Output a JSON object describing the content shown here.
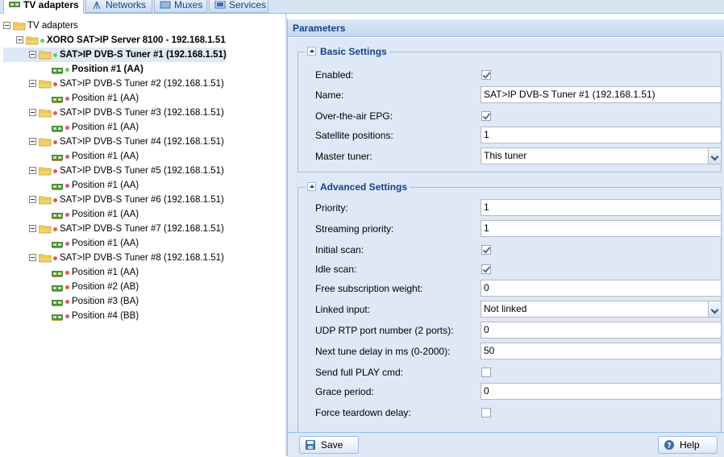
{
  "tabs": [
    {
      "label": "TV adapters",
      "icon": "tv-adapter-icon",
      "active": true
    },
    {
      "label": "Networks",
      "icon": "antenna-icon",
      "active": false
    },
    {
      "label": "Muxes",
      "icon": "mux-icon",
      "active": false
    },
    {
      "label": "Services",
      "icon": "services-icon",
      "active": false
    }
  ],
  "tree": {
    "root": "TV adapters",
    "server": "XORO SAT>IP Server 8100 - 192.168.1.51",
    "tuners": [
      {
        "label": "SAT>IP DVB-S Tuner #1 (192.168.1.51)",
        "status": "green",
        "positions": [
          "Position #1 (AA)"
        ]
      },
      {
        "label": "SAT>IP DVB-S Tuner #2 (192.168.1.51)",
        "status": "red",
        "positions": [
          "Position #1 (AA)"
        ]
      },
      {
        "label": "SAT>IP DVB-S Tuner #3 (192.168.1.51)",
        "status": "red",
        "positions": [
          "Position #1 (AA)"
        ]
      },
      {
        "label": "SAT>IP DVB-S Tuner #4 (192.168.1.51)",
        "status": "red",
        "positions": [
          "Position #1 (AA)"
        ]
      },
      {
        "label": "SAT>IP DVB-S Tuner #5 (192.168.1.51)",
        "status": "red",
        "positions": [
          "Position #1 (AA)"
        ]
      },
      {
        "label": "SAT>IP DVB-S Tuner #6 (192.168.1.51)",
        "status": "red",
        "positions": [
          "Position #1 (AA)"
        ]
      },
      {
        "label": "SAT>IP DVB-S Tuner #7 (192.168.1.51)",
        "status": "red",
        "positions": [
          "Position #1 (AA)"
        ]
      },
      {
        "label": "SAT>IP DVB-S Tuner #8 (192.168.1.51)",
        "status": "red",
        "positions": [
          "Position #1 (AA)",
          "Position #2 (AB)",
          "Position #3 (BA)",
          "Position #4 (BB)"
        ]
      }
    ]
  },
  "panel": {
    "title": "Parameters",
    "basic": {
      "legend": "Basic Settings",
      "enabled_label": "Enabled:",
      "enabled": true,
      "name_label": "Name:",
      "name_value": "SAT>IP DVB-S Tuner #1 (192.168.1.51)",
      "epg_label": "Over-the-air EPG:",
      "epg": true,
      "satpos_label": "Satellite positions:",
      "satpos_value": "1",
      "master_label": "Master tuner:",
      "master_value": "This tuner"
    },
    "advanced": {
      "legend": "Advanced Settings",
      "priority_label": "Priority:",
      "priority_value": "1",
      "stream_label": "Streaming priority:",
      "stream_value": "1",
      "initscan_label": "Initial scan:",
      "initscan": true,
      "idlescan_label": "Idle scan:",
      "idlescan": true,
      "freesub_label": "Free subscription weight:",
      "freesub_value": "0",
      "linked_label": "Linked input:",
      "linked_value": "Not linked",
      "udp_label": "UDP RTP port number (2 ports):",
      "udp_value": "0",
      "nexttune_label": "Next tune delay in ms (0-2000):",
      "nexttune_value": "50",
      "fullplay_label": "Send full PLAY cmd:",
      "fullplay": false,
      "grace_label": "Grace period:",
      "grace_value": "0",
      "teardown_label": "Force teardown delay:",
      "teardown": false
    },
    "save_label": "Save",
    "help_label": "Help"
  },
  "colors": {
    "selected_row": "#dfe8f6",
    "status_green": "#5fcf5f",
    "status_red": "#e25a5a",
    "header_text": "#15428b"
  }
}
